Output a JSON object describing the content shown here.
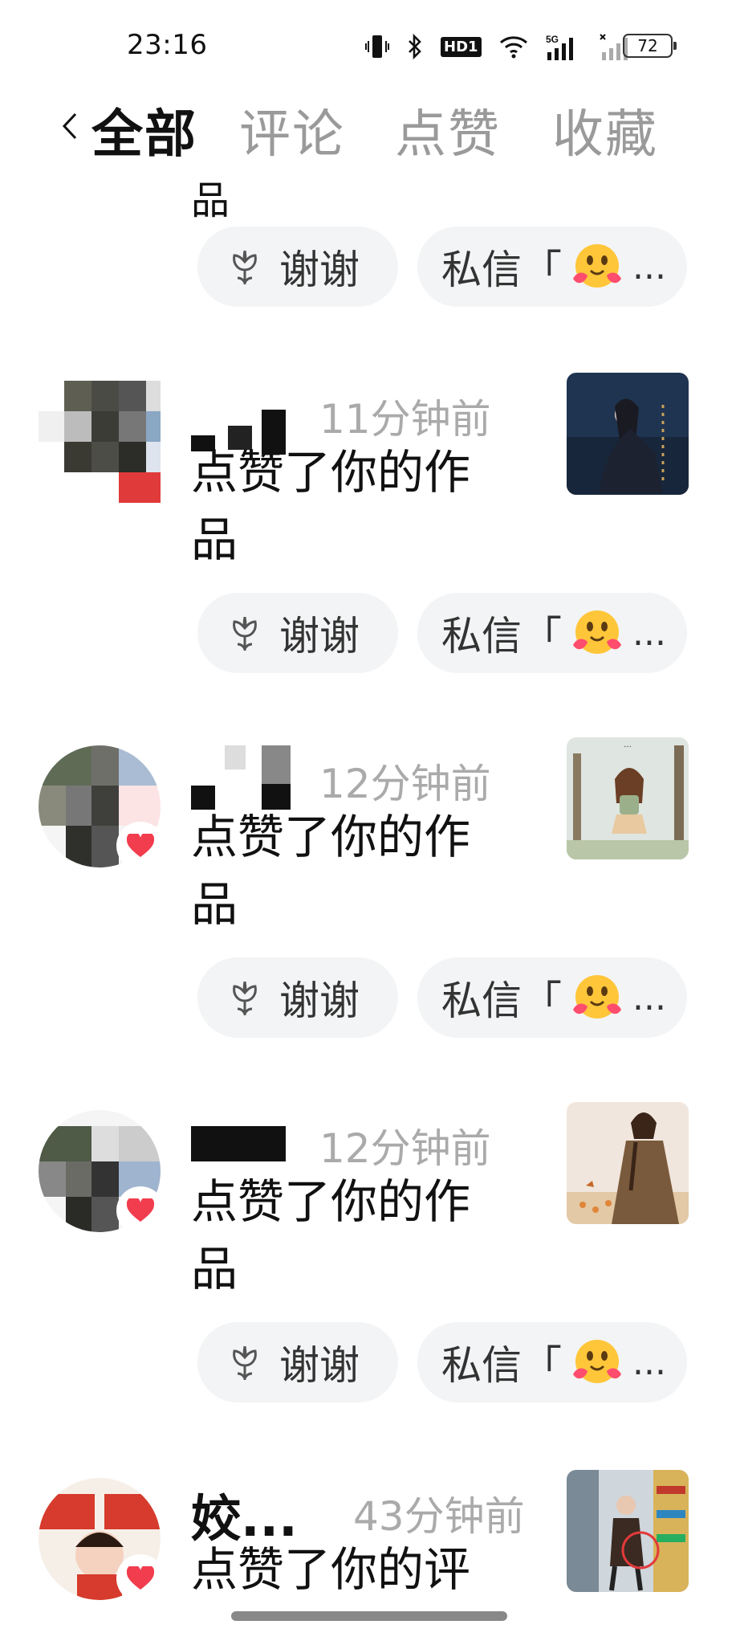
{
  "status_bar": {
    "time": "23:16",
    "hd_label": "HD1",
    "network_label": "5G",
    "battery_level": "72"
  },
  "tabs": [
    {
      "label": "全部",
      "active": true
    },
    {
      "label": "评论",
      "active": false
    },
    {
      "label": "点赞",
      "active": false
    },
    {
      "label": "收藏",
      "active": false
    }
  ],
  "partial_top_text": "品",
  "buttons": {
    "thanks_label": "谢谢",
    "dm_label": "私信「",
    "ellipsis": "..."
  },
  "notifications": [
    {
      "time_ago": "11分钟前",
      "action_text": "点赞了你的作品"
    },
    {
      "time_ago": "12分钟前",
      "action_text": "点赞了你的作品"
    },
    {
      "time_ago": "12分钟前",
      "action_text": "点赞了你的作品"
    },
    {
      "name": "姣...",
      "time_ago": "43分钟前",
      "action_text": "点赞了你的评"
    }
  ],
  "colors": {
    "accent_heart": "#f23d4f",
    "pill_bg": "#f3f4f5",
    "muted_text": "#aaaaaa"
  }
}
